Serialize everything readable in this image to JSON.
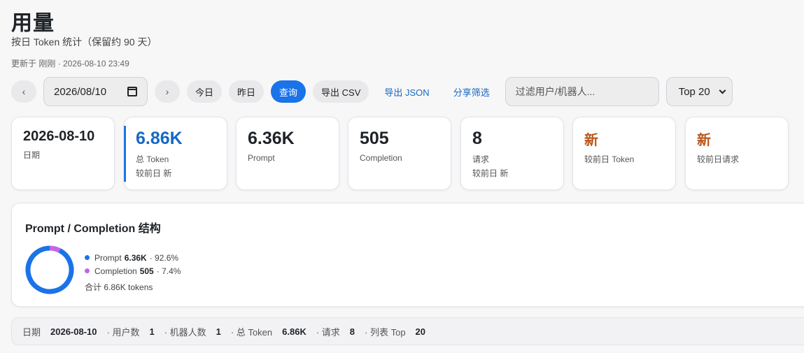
{
  "header": {
    "title": "用量",
    "subtitle": "按日 Token 统计（保留约 90 天）",
    "updated": "更新于 刚刚 · 2026-08-10 23:49"
  },
  "toolbar": {
    "prev_label": "‹",
    "next_label": "›",
    "date_value": "2026/08/10",
    "today_label": "今日",
    "yesterday_label": "昨日",
    "query_label": "查询",
    "export_csv_label": "导出 CSV",
    "export_json_label": "导出 JSON",
    "share_label": "分享筛选",
    "filter_placeholder": "过滤用户/机器人...",
    "top_selected": "Top 20"
  },
  "cards": {
    "date": {
      "value": "2026-08-10",
      "label": "日期"
    },
    "total": {
      "value": "6.86K",
      "label": "总 Token",
      "sub": "较前日 新"
    },
    "prompt": {
      "value": "6.36K",
      "label": "Prompt"
    },
    "completion": {
      "value": "505",
      "label": "Completion"
    },
    "requests": {
      "value": "8",
      "label": "请求",
      "sub": "较前日 新"
    },
    "token_change": {
      "value": "新",
      "label": "较前日 Token"
    },
    "request_change": {
      "value": "新",
      "label": "较前日请求"
    }
  },
  "structure": {
    "title": "Prompt / Completion 结构",
    "prompt_name": "Prompt",
    "prompt_value": "6.36K",
    "prompt_pct": "· 92.6%",
    "prompt_fraction": 0.926,
    "completion_name": "Completion",
    "completion_value": "505",
    "completion_pct": "· 7.4%",
    "completion_fraction": 0.074,
    "total": "合计 6.86K tokens",
    "prompt_color": "#1a73e8",
    "completion_color": "#c266e8"
  },
  "footer": {
    "date_key": "日期",
    "date_val": "2026-08-10",
    "users_key": "· 用户数",
    "users_val": "1",
    "bots_key": "· 机器人数",
    "bots_val": "1",
    "token_key": "· 总 Token",
    "token_val": "6.86K",
    "req_key": "· 请求",
    "req_val": "8",
    "top_key": "· 列表 Top",
    "top_val": "20"
  },
  "colors": {
    "accent": "#1a73e8",
    "link": "#1768c4",
    "new_badge": "#b7571a"
  }
}
